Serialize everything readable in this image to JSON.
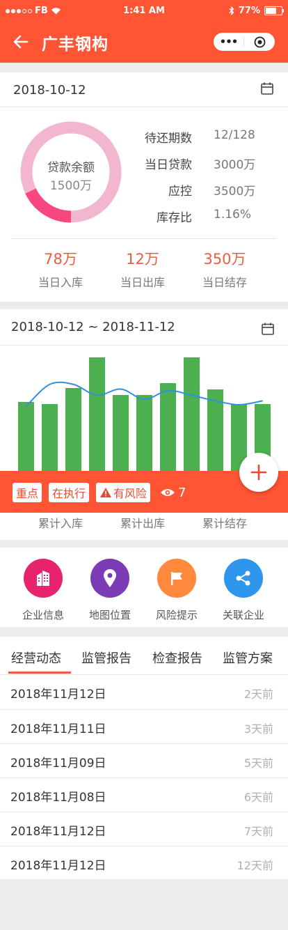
{
  "status_bar": {
    "carrier": "FB",
    "time": "1:41 AM",
    "battery": "77%",
    "battery_level": 0.77
  },
  "nav": {
    "title": "广丰钢构"
  },
  "overview": {
    "date": "2018-10-12",
    "donut": {
      "label": "贷款余额",
      "value": "1500万",
      "highlight_fraction": 0.18,
      "ring_color": "#f2b7cf",
      "highlight_color": "#f8477f"
    },
    "stats": [
      {
        "key": "待还期数",
        "value": "12/128"
      },
      {
        "key": "当日贷款",
        "value": "3000万"
      },
      {
        "key": "应控",
        "value": "3500万"
      },
      {
        "key": "库存比",
        "value": "1.16%"
      }
    ],
    "summary": [
      {
        "value": "78万",
        "label": "当日入库"
      },
      {
        "value": "12万",
        "label": "当日出库"
      },
      {
        "value": "350万",
        "label": "当日结存"
      }
    ]
  },
  "range_card": {
    "date_range": "2018-10-12 ~ 2018-11-12",
    "chart_data": {
      "type": "bar",
      "bar_values": [
        88,
        85,
        106,
        145,
        97,
        97,
        112,
        145,
        104,
        85,
        85
      ],
      "line_values": [
        38,
        66,
        66,
        52,
        60,
        47,
        58,
        52,
        45,
        40,
        45
      ],
      "bar_color": "#4cb050",
      "line_color": "#2f8fe0"
    },
    "tags": [
      "重点",
      "在执行",
      "有风险"
    ],
    "view_count": "7",
    "footer_labels": [
      "累计入库",
      "累计出库",
      "累计结存"
    ]
  },
  "actions": [
    {
      "label": "企业信息",
      "icon": "building-icon",
      "color": "#e8236e"
    },
    {
      "label": "地图位置",
      "icon": "location-pin-icon",
      "color": "#7b3cb6"
    },
    {
      "label": "风险提示",
      "icon": "flag-icon",
      "color": "#ff8a3d"
    },
    {
      "label": "关联企业",
      "icon": "share-icon",
      "color": "#2e96ec"
    }
  ],
  "tabs": {
    "items": [
      "经营动态",
      "监管报告",
      "检查报告",
      "监管方案"
    ],
    "active": 0,
    "accent": "#ea5c42"
  },
  "records": [
    {
      "date": "2018年11月12日",
      "ago": "2天前"
    },
    {
      "date": "2018年11月11日",
      "ago": "3天前"
    },
    {
      "date": "2018年11月09日",
      "ago": "5天前"
    },
    {
      "date": "2018年11月08日",
      "ago": "6天前"
    },
    {
      "date": "2018年11月12日",
      "ago": "7天前"
    },
    {
      "date": "2018年11月12日",
      "ago": "12天前"
    }
  ]
}
